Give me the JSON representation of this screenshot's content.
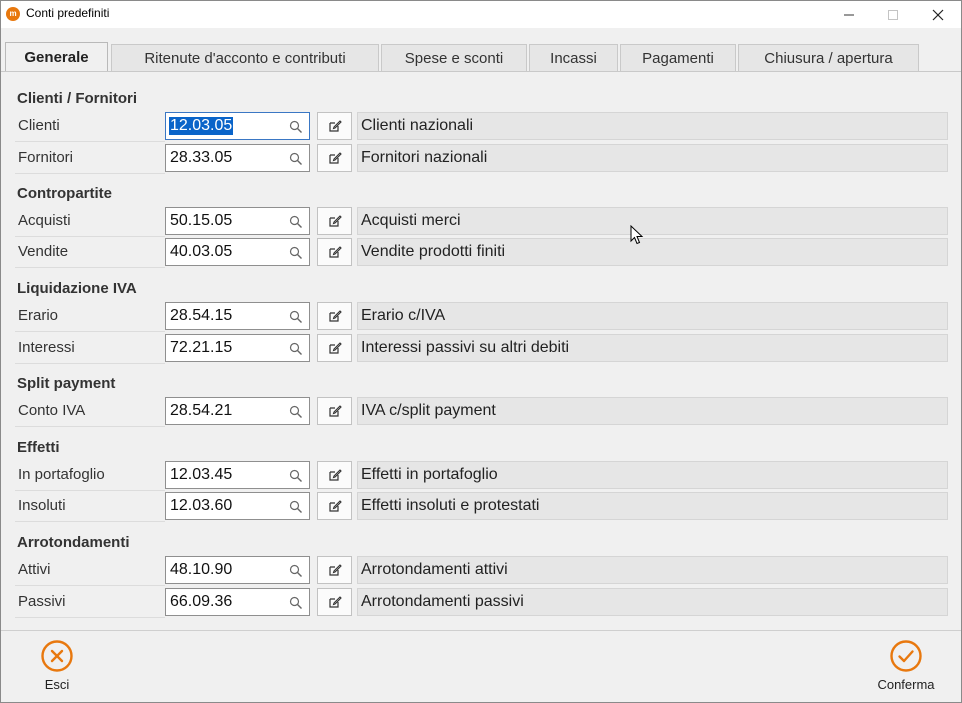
{
  "window": {
    "title": "Conti predefiniti",
    "app_icon": "app-logo-icon"
  },
  "tabs": [
    {
      "label": "Generale",
      "active": true
    },
    {
      "label": "Ritenute d'acconto e contributi",
      "active": false
    },
    {
      "label": "Spese e sconti",
      "active": false
    },
    {
      "label": "Incassi",
      "active": false
    },
    {
      "label": "Pagamenti",
      "active": false
    },
    {
      "label": "Chiusura / apertura",
      "active": false
    }
  ],
  "sections": {
    "clienti_fornitori": {
      "title": "Clienti / Fornitori",
      "rows": [
        {
          "label": "Clienti",
          "code": "12.03.05",
          "description": "Clienti nazionali"
        },
        {
          "label": "Fornitori",
          "code": "28.33.05",
          "description": "Fornitori nazionali"
        }
      ]
    },
    "contropartite": {
      "title": "Contropartite",
      "rows": [
        {
          "label": "Acquisti",
          "code": "50.15.05",
          "description": "Acquisti merci"
        },
        {
          "label": "Vendite",
          "code": "40.03.05",
          "description": "Vendite prodotti finiti"
        }
      ]
    },
    "liquidazione_iva": {
      "title": "Liquidazione IVA",
      "rows": [
        {
          "label": "Erario",
          "code": "28.54.15",
          "description": "Erario c/IVA"
        },
        {
          "label": "Interessi",
          "code": "72.21.15",
          "description": "Interessi passivi su altri debiti"
        }
      ]
    },
    "split_payment": {
      "title": "Split payment",
      "rows": [
        {
          "label": "Conto IVA",
          "code": "28.54.21",
          "description": "IVA c/split payment"
        }
      ]
    },
    "effetti": {
      "title": "Effetti",
      "rows": [
        {
          "label": "In portafoglio",
          "code": "12.03.45",
          "description": "Effetti in portafoglio"
        },
        {
          "label": "Insoluti",
          "code": "12.03.60",
          "description": "Effetti insoluti e protestati"
        }
      ]
    },
    "arrotondamenti": {
      "title": "Arrotondamenti",
      "rows": [
        {
          "label": "Attivi",
          "code": "48.10.90",
          "description": "Arrotondamenti attivi"
        },
        {
          "label": "Passivi",
          "code": "66.09.36",
          "description": "Arrotondamenti passivi"
        }
      ]
    }
  },
  "footer": {
    "cancel_label": "Esci",
    "confirm_label": "Conferma"
  },
  "colors": {
    "accent_orange": "#e8780e",
    "selection_blue": "#0a64c9"
  }
}
